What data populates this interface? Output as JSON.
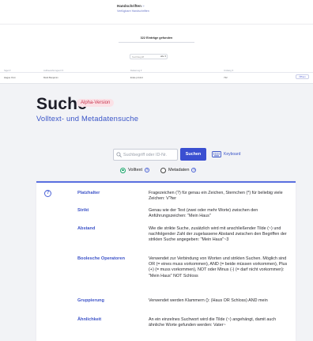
{
  "top": {
    "title": "Handschriften",
    "arrow": "»",
    "subtitle": "Verfügbare Handschriften",
    "found_text": "322 Einträge gefunden",
    "search_placeholder": "Suchbegriff",
    "select_value": "alle ▾",
    "table_headers": [
      "Sigel ▾",
      "Aufbewahrungsort ▾",
      "Datierung ▾",
      "Umfang ▾"
    ],
    "table_row": [
      "Hague Oxm",
      "Mark Benjamin",
      "Ende pr.kind",
      "732"
    ],
    "row_action": "Öffnen"
  },
  "main": {
    "title": "Suche",
    "badge": "Alpha-Version",
    "subtitle": "Volltext- und Metadatensuche"
  },
  "search": {
    "placeholder": "Suchbegriff oder ID-Nr.",
    "button": "Suchen",
    "keyboard_label": "Keyboard"
  },
  "search_mode": {
    "options": [
      {
        "label": "Volltext",
        "checked": true
      },
      {
        "label": "Metadaten",
        "checked": false
      }
    ]
  },
  "help": {
    "rows": [
      {
        "term": "Platzhalter",
        "desc": "Fragezeichen (?) für genau ein Zeichen, Sternchen (*) für beliebig viele Zeichen: V?ter"
      },
      {
        "term": "Strikt",
        "desc": "Genau wie der Text (zwei oder mehr Worte) zwischen den Anführungszeichen: \"Mein Haus\""
      },
      {
        "term": "Abstand",
        "desc": "Wie die strikte Suche, zusätzlich wird mit anschließender Tilde (~) und nachfolgender Zahl der zugelassene Abstand zwischen den Begriffen der strikten Suche angegeben: \"Mein Haus\"~3"
      },
      {
        "term": "Boolesche Operatoren",
        "desc": "Verwendet zur Verbindung von Worten und strikten Suchen. Möglich sind OR (= eines muss vorkommen), AND (= beide müssen vorkommen), Plus (+) (= muss vorkommen), NOT oder Minus (-) (= darf nicht vorkommen): \"Mein Haus\" NOT Schloss"
      },
      {
        "term": "Gruppierung",
        "desc": "Verwendet werden Klammern (): (Haus OR Schloss) AND mein"
      },
      {
        "term": "Ähnlichkeit",
        "desc": "An ein einzelnes Suchwort wird die Tilde (~) angehängt, damit auch ähnliche Worte gefunden werden: Vater~"
      }
    ]
  }
}
